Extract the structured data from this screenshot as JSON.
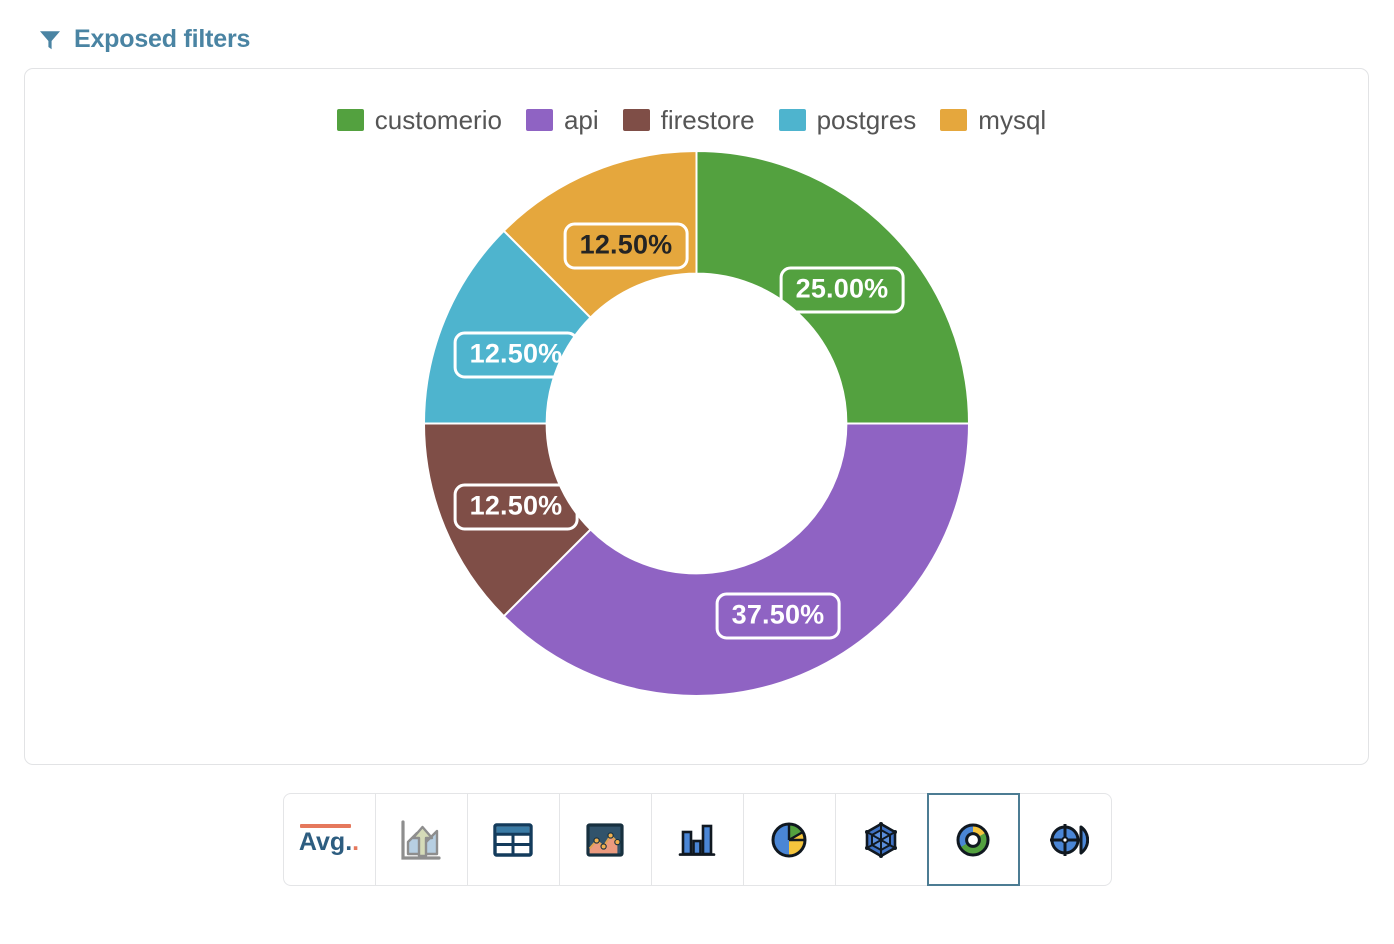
{
  "header": {
    "icon": "funnel-icon",
    "title": "Exposed filters"
  },
  "chart_data": {
    "type": "pie",
    "variant": "donut",
    "title": "",
    "legend_position": "top",
    "labels": [
      "customerio",
      "api",
      "firestore",
      "postgres",
      "mysql"
    ],
    "values": [
      25.0,
      37.5,
      12.5,
      12.5,
      12.5
    ],
    "value_labels": [
      "25.00%",
      "37.50%",
      "12.50%",
      "12.50%",
      "12.50%"
    ],
    "colors": [
      "#53a13f",
      "#8f63c3",
      "#7f4e47",
      "#4eb4ce",
      "#e5a73d"
    ],
    "label_text_colors": [
      "#ffffff",
      "#ffffff",
      "#ffffff",
      "#ffffff",
      "#242424"
    ],
    "start_angle_deg": 0,
    "direction": "clockwise",
    "inner_radius_ratio": 0.55,
    "units": "percent",
    "slices": [
      {
        "name": "customerio",
        "value": 25.0,
        "label": "25.00%",
        "color": "#53a13f"
      },
      {
        "name": "api",
        "value": 37.5,
        "label": "37.50%",
        "color": "#8f63c3"
      },
      {
        "name": "firestore",
        "value": 12.5,
        "label": "12.50%",
        "color": "#7f4e47"
      },
      {
        "name": "postgres",
        "value": 12.5,
        "label": "12.50%",
        "color": "#4eb4ce"
      },
      {
        "name": "mysql",
        "value": 12.5,
        "label": "12.50%",
        "color": "#e5a73d"
      }
    ]
  },
  "legend": {
    "items": [
      {
        "label": "customerio",
        "color": "#53a13f"
      },
      {
        "label": "api",
        "color": "#8f63c3"
      },
      {
        "label": "firestore",
        "color": "#7f4e47"
      },
      {
        "label": "postgres",
        "color": "#4eb4ce"
      },
      {
        "label": "mysql",
        "color": "#e5a73d"
      }
    ]
  },
  "viz_toolbar": {
    "selected_index": 7,
    "buttons": [
      {
        "icon": "big-number-avg-icon",
        "label": "Avg."
      },
      {
        "icon": "trend-area-icon",
        "label": ""
      },
      {
        "icon": "table-icon",
        "label": ""
      },
      {
        "icon": "area-chart-icon",
        "label": ""
      },
      {
        "icon": "bar-chart-icon",
        "label": ""
      },
      {
        "icon": "pie-chart-icon",
        "label": ""
      },
      {
        "icon": "radar-chart-icon",
        "label": ""
      },
      {
        "icon": "donut-chart-icon",
        "label": ""
      },
      {
        "icon": "polar-chart-icon",
        "label": ""
      }
    ]
  },
  "theme": {
    "accent": "#4a84a3",
    "selected_border": "#4c7c93",
    "card_border": "#e2e3e5",
    "text": "#555555",
    "background": "#ffffff"
  }
}
